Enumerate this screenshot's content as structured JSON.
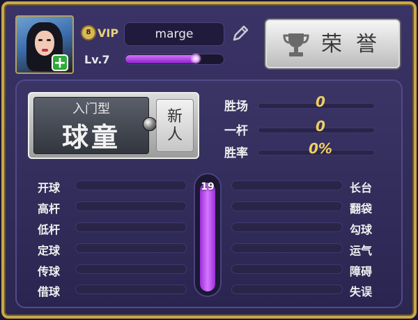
{
  "profile": {
    "vip_level": "8",
    "vip_label": "VIP",
    "username": "marge",
    "level_text": "Lv.7",
    "xp_fraction": 0.72
  },
  "honor_button": {
    "label": "荣誉"
  },
  "rank": {
    "type": "入门型",
    "name": "球童",
    "tag": "新人"
  },
  "stats": [
    {
      "label": "胜场",
      "value": "0"
    },
    {
      "label": "一杆",
      "value": "0"
    },
    {
      "label": "胜率",
      "value": "0%"
    }
  ],
  "skills_left": [
    "开球",
    "高杆",
    "低杆",
    "定球",
    "传球",
    "借球"
  ],
  "skills_right": [
    "长台",
    "翻袋",
    "勾球",
    "运气",
    "障碍",
    "失误"
  ],
  "center_meter": {
    "value": "19"
  },
  "colors": {
    "gold": "#f0d060",
    "purple": "#c45cf6",
    "frame": "#c8a84a"
  },
  "icons": [
    "plus-icon",
    "pencil-icon",
    "trophy-icon",
    "ball-icon"
  ]
}
